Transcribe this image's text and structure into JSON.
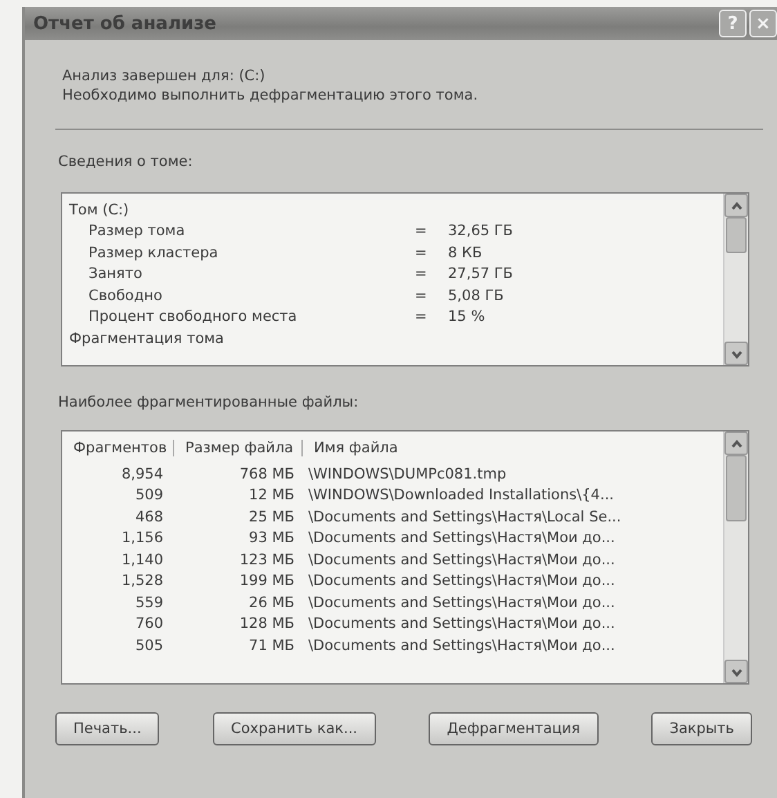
{
  "window": {
    "title": "Отчет об анализе",
    "buttons": [
      "?",
      "×"
    ]
  },
  "summary": [
    "Анализ завершен для: (C:)",
    "Необходимо выполнить дефрагментацию этого тома."
  ],
  "volume_info": {
    "label": "Сведения о томе:",
    "lines": [
      {
        "kind": "heading",
        "label": "Том (C:)"
      },
      {
        "kind": "property",
        "label": "Размер тома",
        "sign": "=",
        "value": "32,65 ГБ"
      },
      {
        "kind": "property",
        "label": "Размер кластера",
        "sign": "=",
        "value": "8 КБ"
      },
      {
        "kind": "property",
        "label": "Занято",
        "sign": "=",
        "value": "27,57 ГБ"
      },
      {
        "kind": "property",
        "label": "Свободно",
        "sign": "=",
        "value": "5,08 ГБ"
      },
      {
        "kind": "property",
        "label": "Процент свободного места",
        "sign": "=",
        "value": "15 %"
      },
      {
        "kind": "heading",
        "label": "Фрагментация тома"
      }
    ]
  },
  "files": {
    "label": "Наиболее фрагментированные файлы:",
    "columns": [
      "Фрагментов",
      "Размер файла",
      "Имя файла"
    ],
    "rows": [
      [
        "8,954",
        "768 МБ",
        "\\WINDOWS\\DUMPc081.tmp"
      ],
      [
        "509",
        "12 МБ",
        "\\WINDOWS\\Downloaded Installations\\{4..."
      ],
      [
        "468",
        "25 МБ",
        "\\Documents and Settings\\Настя\\Local Se..."
      ],
      [
        "1,156",
        "93 МБ",
        "\\Documents and Settings\\Настя\\Мои до..."
      ],
      [
        "1,140",
        "123 МБ",
        "\\Documents and Settings\\Настя\\Мои до..."
      ],
      [
        "1,528",
        "199 МБ",
        "\\Documents and Settings\\Настя\\Мои до..."
      ],
      [
        "559",
        "26 МБ",
        "\\Documents and Settings\\Настя\\Мои до..."
      ],
      [
        "760",
        "128 МБ",
        "\\Documents and Settings\\Настя\\Мои до..."
      ],
      [
        "505",
        "71 МБ",
        "\\Documents and Settings\\Настя\\Мои до..."
      ]
    ]
  },
  "buttons": [
    "Печать...",
    "Сохранить как...",
    "Дефрагментация",
    "Закрыть"
  ]
}
